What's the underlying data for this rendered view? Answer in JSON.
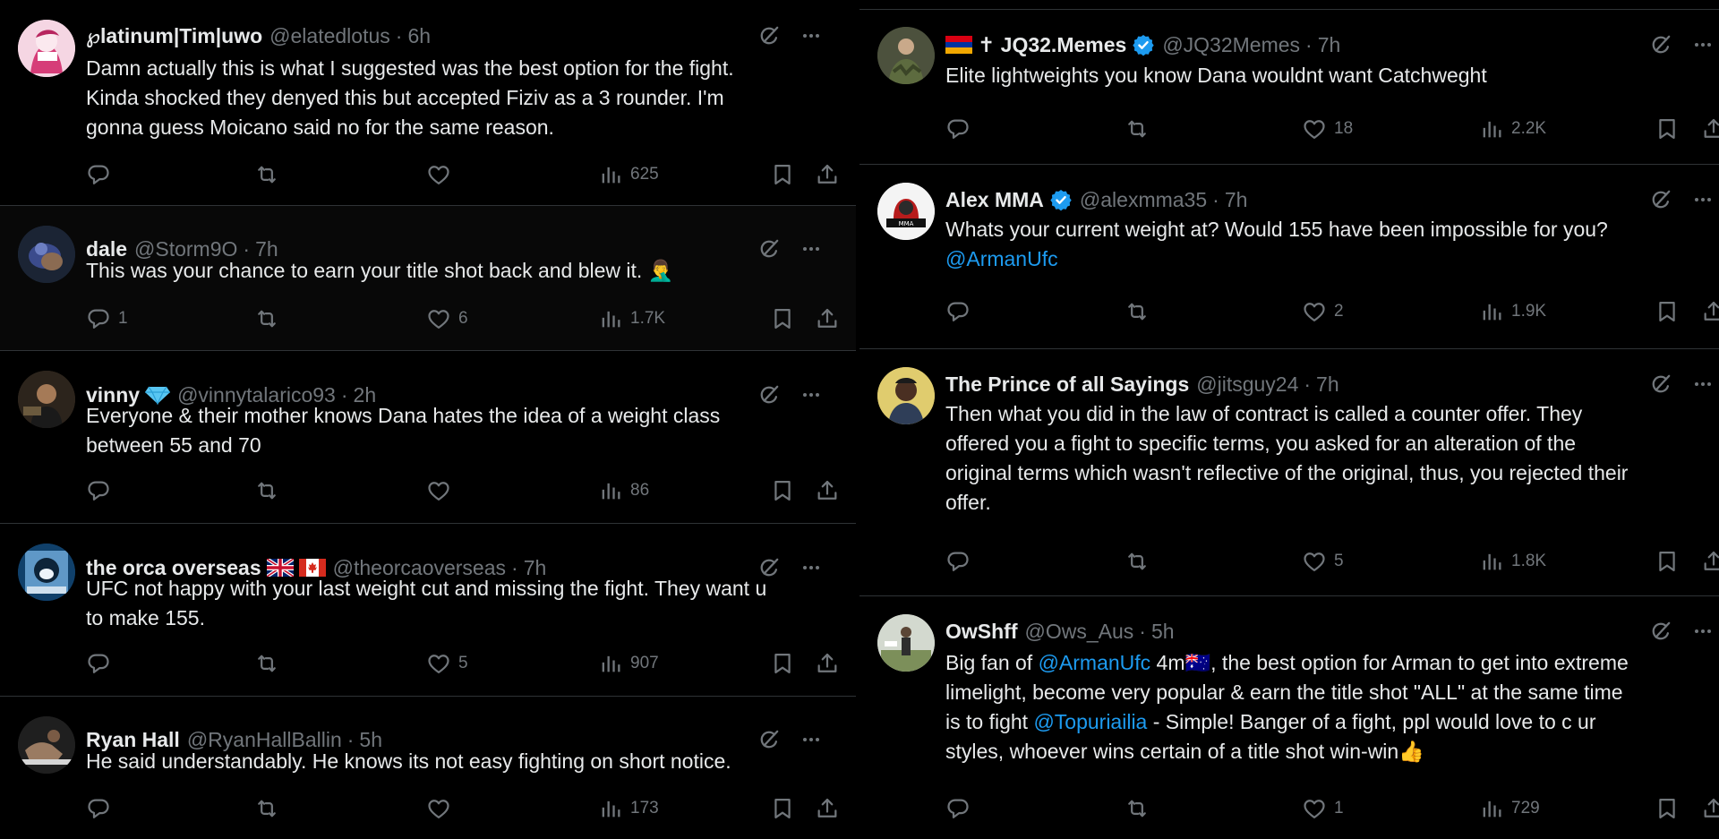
{
  "colors": {
    "background": "#000000",
    "text": "#e7e9ea",
    "secondary": "#71767b",
    "link": "#1d9bf0",
    "verified": "#1d9bf0",
    "divider": "#2f3336"
  },
  "left_column": {
    "tweets": [
      {
        "name": "℘latinum|Tim|uwo",
        "handle": "@elatedlotus",
        "time": "6h",
        "text_lines": [
          "Damn actually this is what I suggested was the best option for the fight.",
          "Kinda shocked they denyed this but accepted Fiziv as a 3 rounder. I'm",
          "gonna guess Moicano said no for the same reason."
        ],
        "replies": "",
        "retweets": "",
        "likes": "",
        "views": "625"
      },
      {
        "name": "dale",
        "handle": "@Storm9O",
        "time": "7h",
        "text_lines": [
          "This was your chance to earn your title shot back and blew it. 🤦‍♂️"
        ],
        "replies": "1",
        "retweets": "",
        "likes": "6",
        "views": "1.7K"
      },
      {
        "name": "vinny",
        "handle": "@vinnytalarico93",
        "time": "2h",
        "badge_icon": "diamond-emoji",
        "text_lines": [
          "Everyone & their mother knows Dana hates the idea of a weight class",
          "between 55 and 70"
        ],
        "replies": "",
        "retweets": "",
        "likes": "",
        "views": "86"
      },
      {
        "name": "the orca overseas",
        "handle": "@theorcaoverseas",
        "time": "7h",
        "badge_icon": "uk-and-canada-flags",
        "text_lines": [
          "UFC not happy with your last weight cut and missing the fight. They want u",
          "to make 155."
        ],
        "replies": "",
        "retweets": "",
        "likes": "5",
        "views": "907"
      },
      {
        "name": "Ryan Hall",
        "handle": "@RyanHallBallin",
        "time": "5h",
        "text_lines": [
          "He said understandably. He knows its not easy fighting on short notice."
        ],
        "replies": "",
        "retweets": "",
        "likes": "",
        "views": "173"
      }
    ]
  },
  "right_column": {
    "tweets": [
      {
        "name": "✝ JQ32.Memes",
        "handle": "@JQ32Memes",
        "time": "7h",
        "prefix_icon": "armenia-flag",
        "verified": true,
        "text_lines": [
          "Elite lightweights you know Dana wouldnt want Catchweght"
        ],
        "replies": "",
        "retweets": "",
        "likes": "18",
        "views": "2.2K"
      },
      {
        "name": "Alex MMA",
        "handle": "@alexmma35",
        "time": "7h",
        "verified": true,
        "text_lines": [
          "Whats your current weight at? Would 155 have been impossible for you?"
        ],
        "mention_line": "@ArmanUfc",
        "replies": "",
        "retweets": "",
        "likes": "2",
        "views": "1.9K"
      },
      {
        "name": "The Prince of all Sayings",
        "handle": "@jitsguy24",
        "time": "7h",
        "text_lines": [
          "Then what you did in the law of contract is called a counter offer. They",
          "offered you a fight to specific terms, you asked for an alteration of the",
          "original terms which wasn't reflective of the original, thus, you rejected their",
          "offer."
        ],
        "replies": "",
        "retweets": "",
        "likes": "5",
        "views": "1.8K"
      },
      {
        "name": "OwShff",
        "handle": "@Ows_Aus",
        "time": "5h",
        "text": {
          "l1_pre": "Big fan of ",
          "l1_mention": "@ArmanUfc",
          "l1_post": " 4m🇦🇺, the best option for Arman to get into extreme",
          "l2": "limelight, become very popular & earn the title shot \"ALL\" at the same time",
          "l3_pre": "is to fight ",
          "l3_mention": "@Topuriailia",
          "l3_post": " - Simple! Banger of a fight, ppl would love to c ur",
          "l4": "styles, whoever wins certain of a title shot win-win👍"
        },
        "replies": "",
        "retweets": "",
        "likes": "1",
        "views": "729"
      }
    ]
  }
}
